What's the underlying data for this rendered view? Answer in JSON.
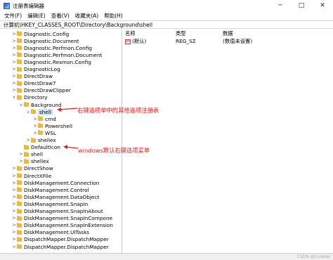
{
  "window": {
    "title": "注册表编辑器",
    "controls": {
      "minimize": "─",
      "maximize": "□",
      "close": "✕"
    }
  },
  "menu": [
    "文件(F)",
    "编辑(E)",
    "查看(V)",
    "收藏夹(A)",
    "帮助(H)"
  ],
  "address": "计算机\\HKEY_CLASSES_ROOT\\Directory\\Background\\shell",
  "tree": [
    {
      "label": "Diagnostic.Config",
      "chevron": ">"
    },
    {
      "label": "Diagnostic.Document",
      "chevron": ">"
    },
    {
      "label": "Diagnostic.Perfmon.Config",
      "chevron": ">"
    },
    {
      "label": "Diagnostic.Perfmon.Document",
      "chevron": ">"
    },
    {
      "label": "Diagnostic.Resmon.Config",
      "chevron": ">"
    },
    {
      "label": "DiagnosticLog",
      "chevron": ">"
    },
    {
      "label": "DirectDraw",
      "chevron": ">"
    },
    {
      "label": "DirectDraw7",
      "chevron": ">"
    },
    {
      "label": "DirectDrawClipper",
      "chevron": ">"
    },
    {
      "label": "Directory",
      "chevron": "v"
    },
    {
      "label": "Background",
      "chevron": "v"
    },
    {
      "label": "shell",
      "chevron": "v"
    },
    {
      "label": "cmd",
      "chevron": ">"
    },
    {
      "label": "Powershell",
      "chevron": ">"
    },
    {
      "label": "WSL",
      "chevron": ">"
    },
    {
      "label": "shellex",
      "chevron": ">"
    },
    {
      "label": "DefaultIcon",
      "chevron": ""
    },
    {
      "label": "shell",
      "chevron": ">"
    },
    {
      "label": "shellex",
      "chevron": ">"
    },
    {
      "label": "DirectShow",
      "chevron": ">"
    },
    {
      "label": "DirectXFile",
      "chevron": ">"
    },
    {
      "label": "DiskManagement.Connection",
      "chevron": ">"
    },
    {
      "label": "DiskManagement.Control",
      "chevron": ">"
    },
    {
      "label": "DiskManagement.DataObject",
      "chevron": ">"
    },
    {
      "label": "DiskManagement.SnapIn",
      "chevron": ">"
    },
    {
      "label": "DiskManagement.SnapInAbout",
      "chevron": ">"
    },
    {
      "label": "DiskManagement.SnapInCompone",
      "chevron": ">"
    },
    {
      "label": "DiskManagement.SnapInExtension",
      "chevron": ">"
    },
    {
      "label": "DiskManagement.UITasks",
      "chevron": ">"
    },
    {
      "label": "DispatchMapper.DispatchMapper",
      "chevron": ">"
    },
    {
      "label": "DispatchMapper.DispatchMapper",
      "chevron": ">"
    }
  ],
  "list": {
    "headers": {
      "name": "名称",
      "type": "类型",
      "data": "数据"
    },
    "rows": [
      {
        "icon": "ab",
        "name": "(默认)",
        "type": "REG_SZ",
        "data": "(数值未设置)"
      }
    ]
  },
  "annotations": {
    "shell": "右键选项单中的其他选项注册表",
    "defaulticon": "windows默认右键选项菜单"
  },
  "status_watermark": "CSDN @Corelas",
  "colors": {
    "annotation": "#e0201c",
    "selection": "#cce4f7",
    "folder": "#e8b84a"
  }
}
